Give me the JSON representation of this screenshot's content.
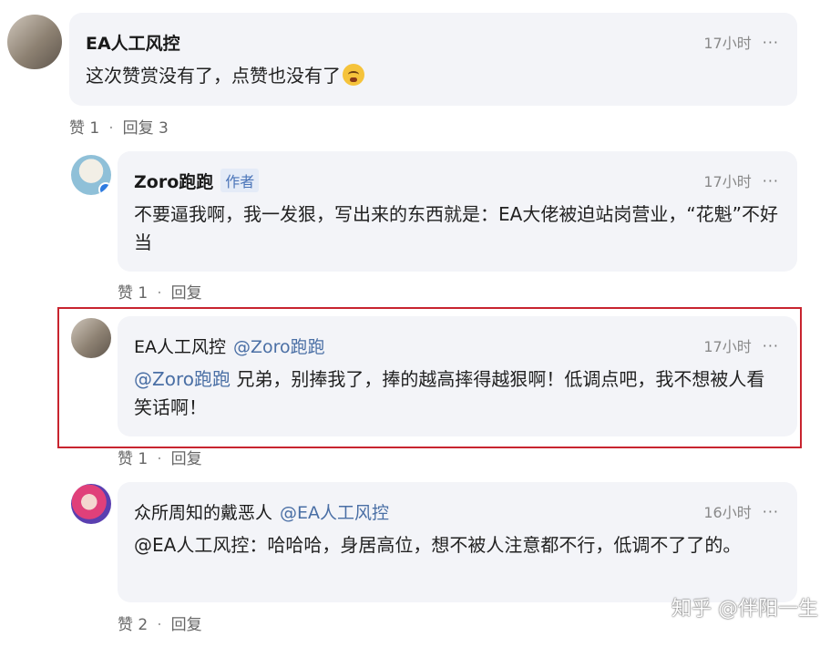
{
  "comments": [
    {
      "author": "EA人工风控",
      "time": "17小时",
      "more": "···",
      "text": "这次赞赏没有了，点赞也没有了",
      "like_label": "赞 1",
      "reply_label": "回复 3"
    },
    {
      "author": "Zoro跑跑",
      "author_tag": "作者",
      "time": "17小时",
      "more": "···",
      "text": "不要逼我啊，我一发狠，写出来的东西就是：EA大佬被迫站岗营业，“花魁”不好当",
      "like_label": "赞 1",
      "reply_label": "回复"
    },
    {
      "author": "EA人工风控",
      "reply_to": "@Zoro跑跑",
      "time": "17小时",
      "more": "···",
      "mention": "@Zoro跑跑",
      "text": " 兄弟，别捧我了，捧的越高摔得越狠啊！低调点吧，我不想被人看笑话啊！",
      "like_label": "赞 1",
      "reply_label": "回复"
    },
    {
      "author": "众所周知的戴恶人",
      "reply_to": "@EA人工风控",
      "time": "16小时",
      "more": "···",
      "text": "@EA人工风控：哈哈哈，身居高位，想不被人注意都不行，低调不了了的。",
      "like_label": "赞 2",
      "reply_label": "回复"
    }
  ],
  "watermark": "知乎 @伴阳一生",
  "colors": {
    "bubble": "#f3f4f8",
    "mention": "#4a6fa5",
    "highlight": "#c8242f"
  }
}
